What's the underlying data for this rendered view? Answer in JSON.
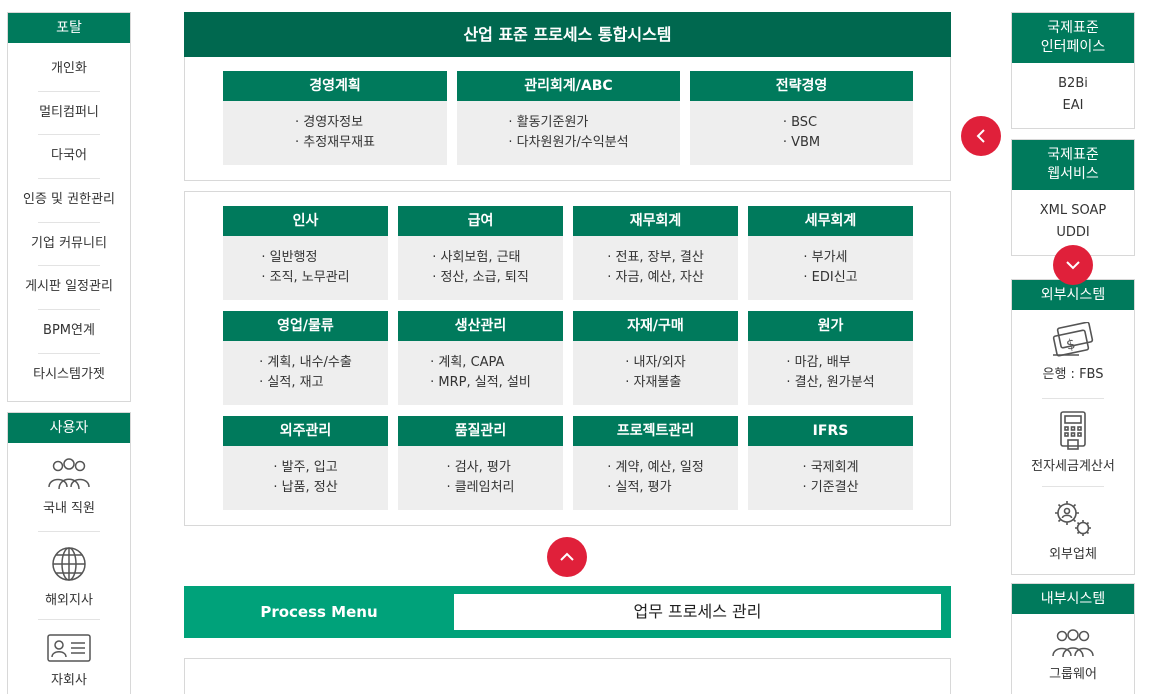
{
  "left": {
    "portal_title": "포탈",
    "portal_items": [
      "개인화",
      "멀티컴퍼니",
      "다국어",
      "인증 및 권한관리",
      "기업 커뮤니티",
      "게시판 일정관리",
      "BPM연계",
      "타시스템가젯"
    ],
    "users_title": "사용자",
    "user_items": [
      {
        "label": "국내 직원",
        "icon": "users-group-icon"
      },
      {
        "label": "해외지사",
        "icon": "globe-icon"
      },
      {
        "label": "자회사",
        "icon": "id-card-icon"
      }
    ]
  },
  "center": {
    "title": "산업 표준 프로세스 통합시스템",
    "top_cards": [
      {
        "title": "경영계획",
        "lines": [
          "· 경영자정보",
          "· 추정재무재표"
        ]
      },
      {
        "title": "관리회계/ABC",
        "lines": [
          "· 활동기준원가",
          "· 다차원원가/수익분석"
        ]
      },
      {
        "title": "전략경영",
        "lines": [
          "· BSC",
          "· VBM"
        ]
      }
    ],
    "grid_cards": [
      {
        "title": "인사",
        "lines": [
          "· 일반행정",
          "· 조직, 노무관리"
        ]
      },
      {
        "title": "급여",
        "lines": [
          "· 사회보험, 근태",
          "· 정산, 소급, 퇴직"
        ]
      },
      {
        "title": "재무회계",
        "lines": [
          "· 전표, 장부, 결산",
          "· 자금, 예산, 자산"
        ]
      },
      {
        "title": "세무회계",
        "lines": [
          "· 부가세",
          "· EDI신고"
        ]
      },
      {
        "title": "영업/물류",
        "lines": [
          "· 계획, 내수/수출",
          "· 실적, 재고"
        ]
      },
      {
        "title": "생산관리",
        "lines": [
          "· 계획, CAPA",
          "· MRP, 실적, 설비"
        ]
      },
      {
        "title": "자재/구매",
        "lines": [
          "· 내자/외자",
          "· 자재불출"
        ]
      },
      {
        "title": "원가",
        "lines": [
          "· 마감, 배부",
          "· 결산, 원가분석"
        ]
      },
      {
        "title": "외주관리",
        "lines": [
          "· 발주, 입고",
          "· 납품, 정산"
        ]
      },
      {
        "title": "품질관리",
        "lines": [
          "· 검사, 평가",
          "· 클레임처리"
        ]
      },
      {
        "title": "프로젝트관리",
        "lines": [
          "· 계약, 예산, 일정",
          "· 실적, 평가"
        ]
      },
      {
        "title": "IFRS",
        "lines": [
          "· 국제회계",
          "· 기준결산"
        ]
      }
    ],
    "process_menu_label": "Process Menu",
    "process_menu_value": "업무 프로세스 관리"
  },
  "right": {
    "intl_interface_title_1": "국제표준",
    "intl_interface_title_2": "인터페이스",
    "intl_interface_lines": [
      "B2Bi",
      "EAI"
    ],
    "intl_web_title_1": "국제표준",
    "intl_web_title_2": "웹서비스",
    "intl_web_lines": [
      "XML SOAP",
      "UDDI"
    ],
    "external_title": "외부시스템",
    "external_items": [
      {
        "label": "은행 : FBS",
        "icon": "bank-bill-icon"
      },
      {
        "label": "전자세금계산서",
        "icon": "calculator-icon"
      },
      {
        "label": "외부업체",
        "icon": "gear-person-icon"
      }
    ],
    "internal_title": "내부시스템",
    "internal_items": [
      {
        "label": "그룹웨어",
        "icon": "users-group-icon"
      }
    ]
  },
  "colors": {
    "title_green": "#00684f",
    "header_green": "#007a5c",
    "process_green": "#00a27a",
    "accent_red": "#e0203a",
    "card_bg": "#eeeeee"
  }
}
